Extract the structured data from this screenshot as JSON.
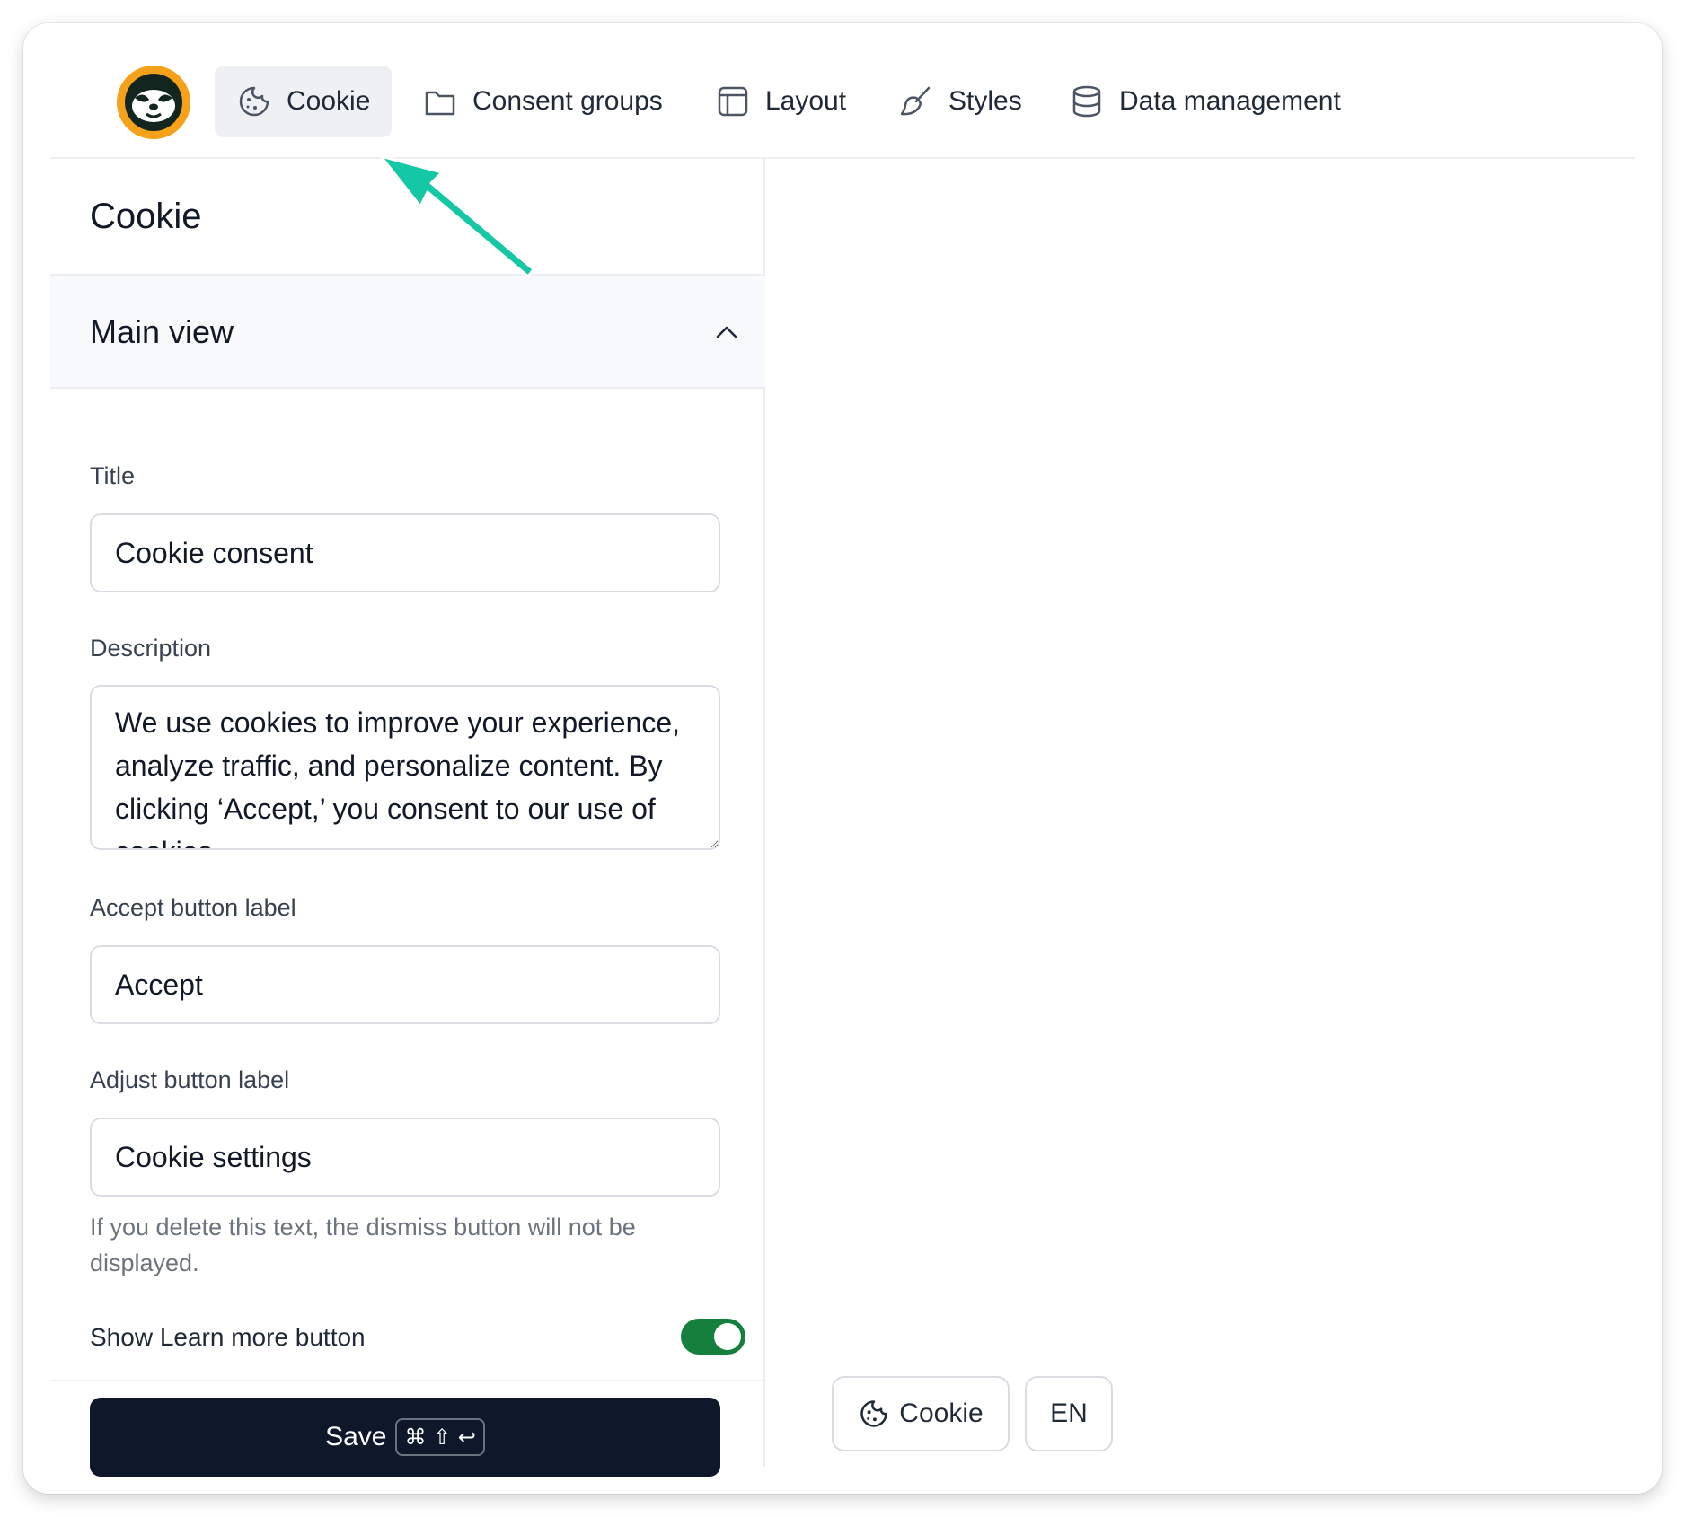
{
  "nav": {
    "tabs": [
      {
        "label": "Cookie",
        "icon": "cookie-icon",
        "active": true
      },
      {
        "label": "Consent groups",
        "icon": "folder-icon",
        "active": false
      },
      {
        "label": "Layout",
        "icon": "layout-icon",
        "active": false
      },
      {
        "label": "Styles",
        "icon": "brush-icon",
        "active": false
      },
      {
        "label": "Data management",
        "icon": "database-icon",
        "active": false
      }
    ]
  },
  "panel": {
    "title": "Cookie",
    "section_title": "Main view",
    "fields": {
      "title_label": "Title",
      "title_value": "Cookie consent",
      "description_label": "Description",
      "description_value": "We use cookies to improve your experience, analyze traffic, and personalize content. By clicking ‘Accept,’ you consent to our use of cookies.",
      "accept_label": "Accept button label",
      "accept_value": "Accept",
      "adjust_label": "Adjust button label",
      "adjust_value": "Cookie settings",
      "adjust_hint": "If you delete this text, the dismiss button will not be displayed.",
      "learn_more_label": "Show Learn more button",
      "learn_more_enabled": true
    },
    "save_label": "Save",
    "save_shortcut": "⌘ ⇧ ↩"
  },
  "preview": {
    "cookie_button_label": "Cookie",
    "language_label": "EN"
  },
  "colors": {
    "accent_arrow": "#14c7a5",
    "toggle_on": "#15803d",
    "save_bg": "#0f172a",
    "logo_bg": "#f5a11a"
  }
}
